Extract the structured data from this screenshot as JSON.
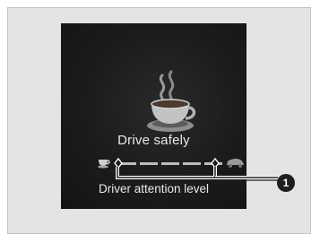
{
  "screen": {
    "message": "Drive safely",
    "meter_label": "Driver attention level",
    "meter_segments_total": 5,
    "callout_number": "1"
  },
  "icons": {
    "main": "coffee-cup-icon",
    "meter_left": "coffee-cup-icon",
    "meter_right": "car-icon",
    "markers": "diamond-marker-icon"
  },
  "colors": {
    "panel_background": "#e4e4e4",
    "display_background": "#1b1b1b",
    "text": "#e9e9e9",
    "callout": "#1e1e1e"
  }
}
